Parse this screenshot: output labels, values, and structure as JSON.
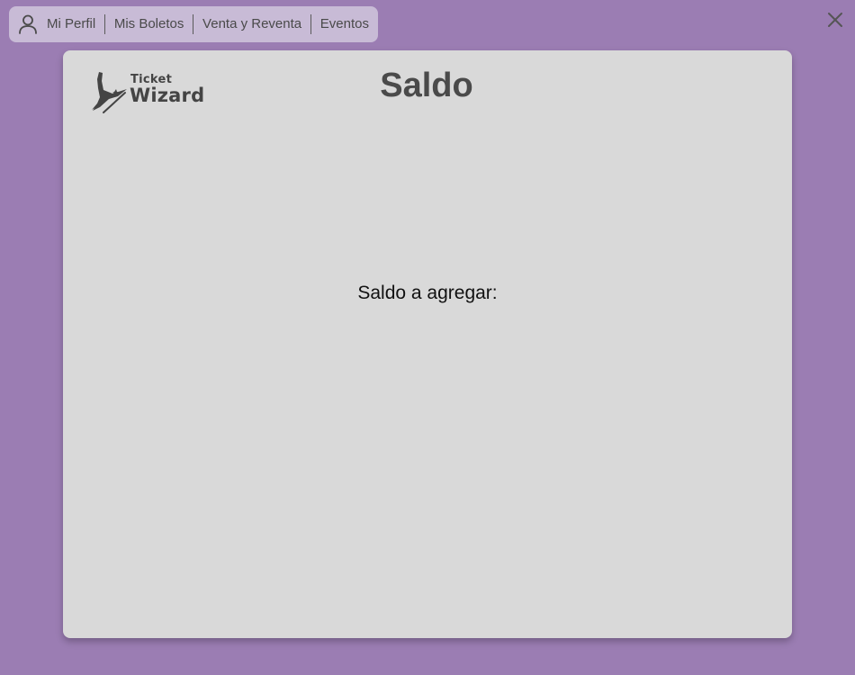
{
  "nav": {
    "icon": "user-icon",
    "items": [
      "Mi Perfil",
      "Mis Boletos",
      "Venta y Reventa",
      "Eventos"
    ]
  },
  "close_icon": "close-icon",
  "logo": {
    "line1": "Ticket",
    "line2": "Wizard"
  },
  "panel": {
    "title": "Saldo",
    "saldo_label": "Saldo a agregar:"
  },
  "colors": {
    "background": "#9b7db3",
    "nav_bg": "#c8bbd6",
    "panel_bg": "#d9d9d9",
    "text_dark": "#4a4a4a"
  }
}
